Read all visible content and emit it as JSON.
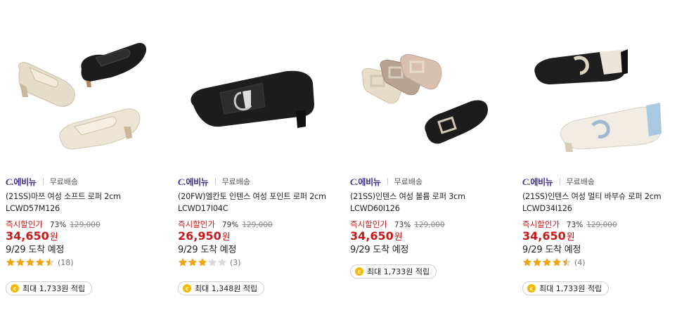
{
  "products": [
    {
      "brand_prefix": "C.",
      "brand_name": "에비뉴",
      "shipping": "무료배송",
      "title": "(21SS)마쯔 여성 소프트 로퍼 2cm LCWD57M126",
      "discount_label": "즉시할인가",
      "discount_rate": "73%",
      "original_price": "129,000",
      "price": "34,650",
      "price_unit": "원",
      "delivery": "9/29 도착 예정",
      "rating_stars": 4.5,
      "review_count": "(18)",
      "points": "최대 1,733원 적립"
    },
    {
      "brand_prefix": "C.",
      "brand_name": "에비뉴",
      "shipping": "무료배송",
      "title": "(20FW)엘칸토 인텐스 여성 포인트 로퍼 2cm LCWD17I04C",
      "discount_label": "즉시할인가",
      "discount_rate": "79%",
      "original_price": "129,000",
      "price": "26,950",
      "price_unit": "원",
      "delivery": "9/29 도착 예정",
      "rating_stars": 3,
      "review_count": "(3)",
      "points": "최대 1,348원 적립"
    },
    {
      "brand_prefix": "C.",
      "brand_name": "에비뉴",
      "shipping": "무료배송",
      "title": "(21SS)인텐스 여성 볼륨 로퍼 3cm LCWD60I126",
      "discount_label": "즉시할인가",
      "discount_rate": "73%",
      "original_price": "129,000",
      "price": "34,650",
      "price_unit": "원",
      "delivery": "9/29 도착 예정",
      "points": "최대 1,733원 적립"
    },
    {
      "brand_prefix": "C.",
      "brand_name": "에비뉴",
      "shipping": "무료배송",
      "title": "(21SS)인텐스 여성 멀티 바부슈 로퍼 2cm LCWD34I126",
      "discount_label": "즉시할인가",
      "discount_rate": "73%",
      "original_price": "129,000",
      "price": "34,650",
      "price_unit": "원",
      "delivery": "9/29 도착 예정",
      "rating_stars": 4.5,
      "review_count": "(4)",
      "points": "최대 1,733원 적립"
    }
  ],
  "colors": {
    "price_red": "#c81919",
    "brand_purple": "#3b2f8f",
    "star_gold": "#f0a30a",
    "coin_yellow": "#f5b800"
  }
}
